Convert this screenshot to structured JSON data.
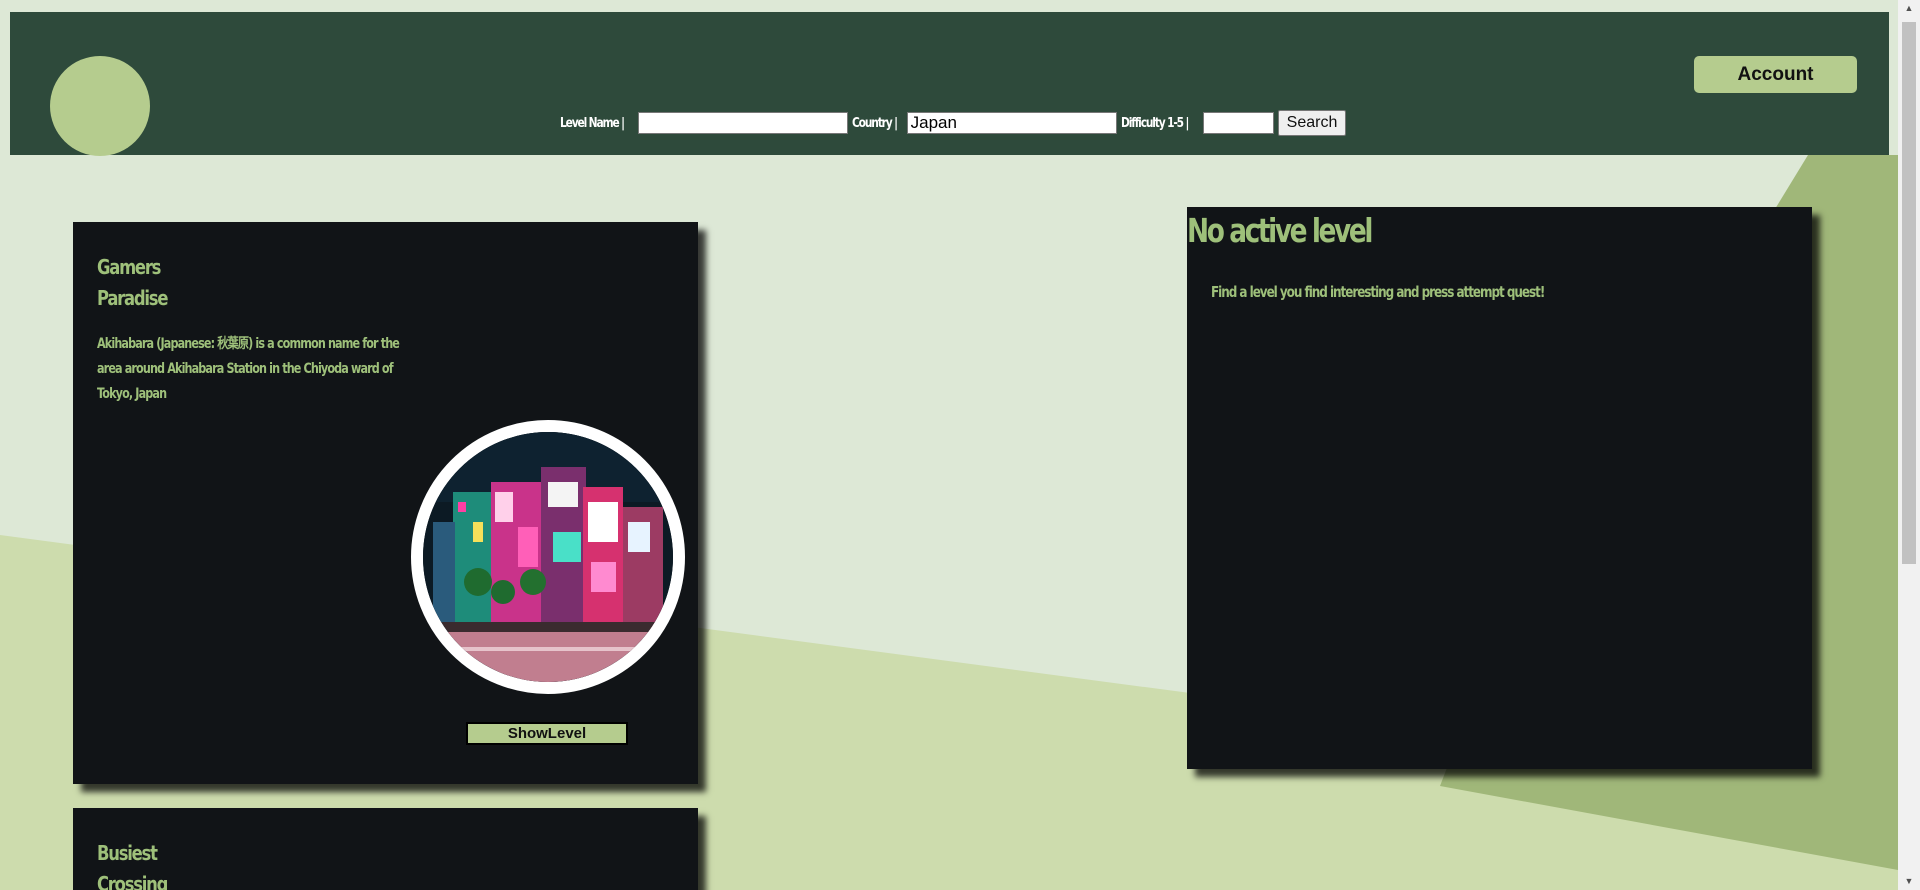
{
  "header": {
    "account_label": "Account",
    "logo": "logo-circle"
  },
  "search": {
    "level_name_label": "Level Name |",
    "level_name_value": "",
    "country_label": "Country |",
    "country_value": "Japan",
    "difficulty_label": "Difficulty 1-5 |",
    "difficulty_value": "",
    "search_label": "Search"
  },
  "levels": [
    {
      "title_line1": "Gamers",
      "title_line2": "Paradise",
      "description": "Akihabara (Japanese: 秋葉原) is a common name for the area around Akihabara Station in the Chiyoda ward of Tokyo, Japan",
      "button_label": "ShowLevel"
    },
    {
      "title_line1": "Busiest",
      "title_line2": "Crossing"
    }
  ],
  "active_panel": {
    "title": "No active level",
    "message": "Find a level you find interesting and press attempt quest!"
  },
  "colors": {
    "header_bg": "#2e4a3b",
    "accent": "#b5cc8e",
    "card_bg": "#111417",
    "card_text": "#9ec07a",
    "page_bg": "#dde8d6"
  }
}
